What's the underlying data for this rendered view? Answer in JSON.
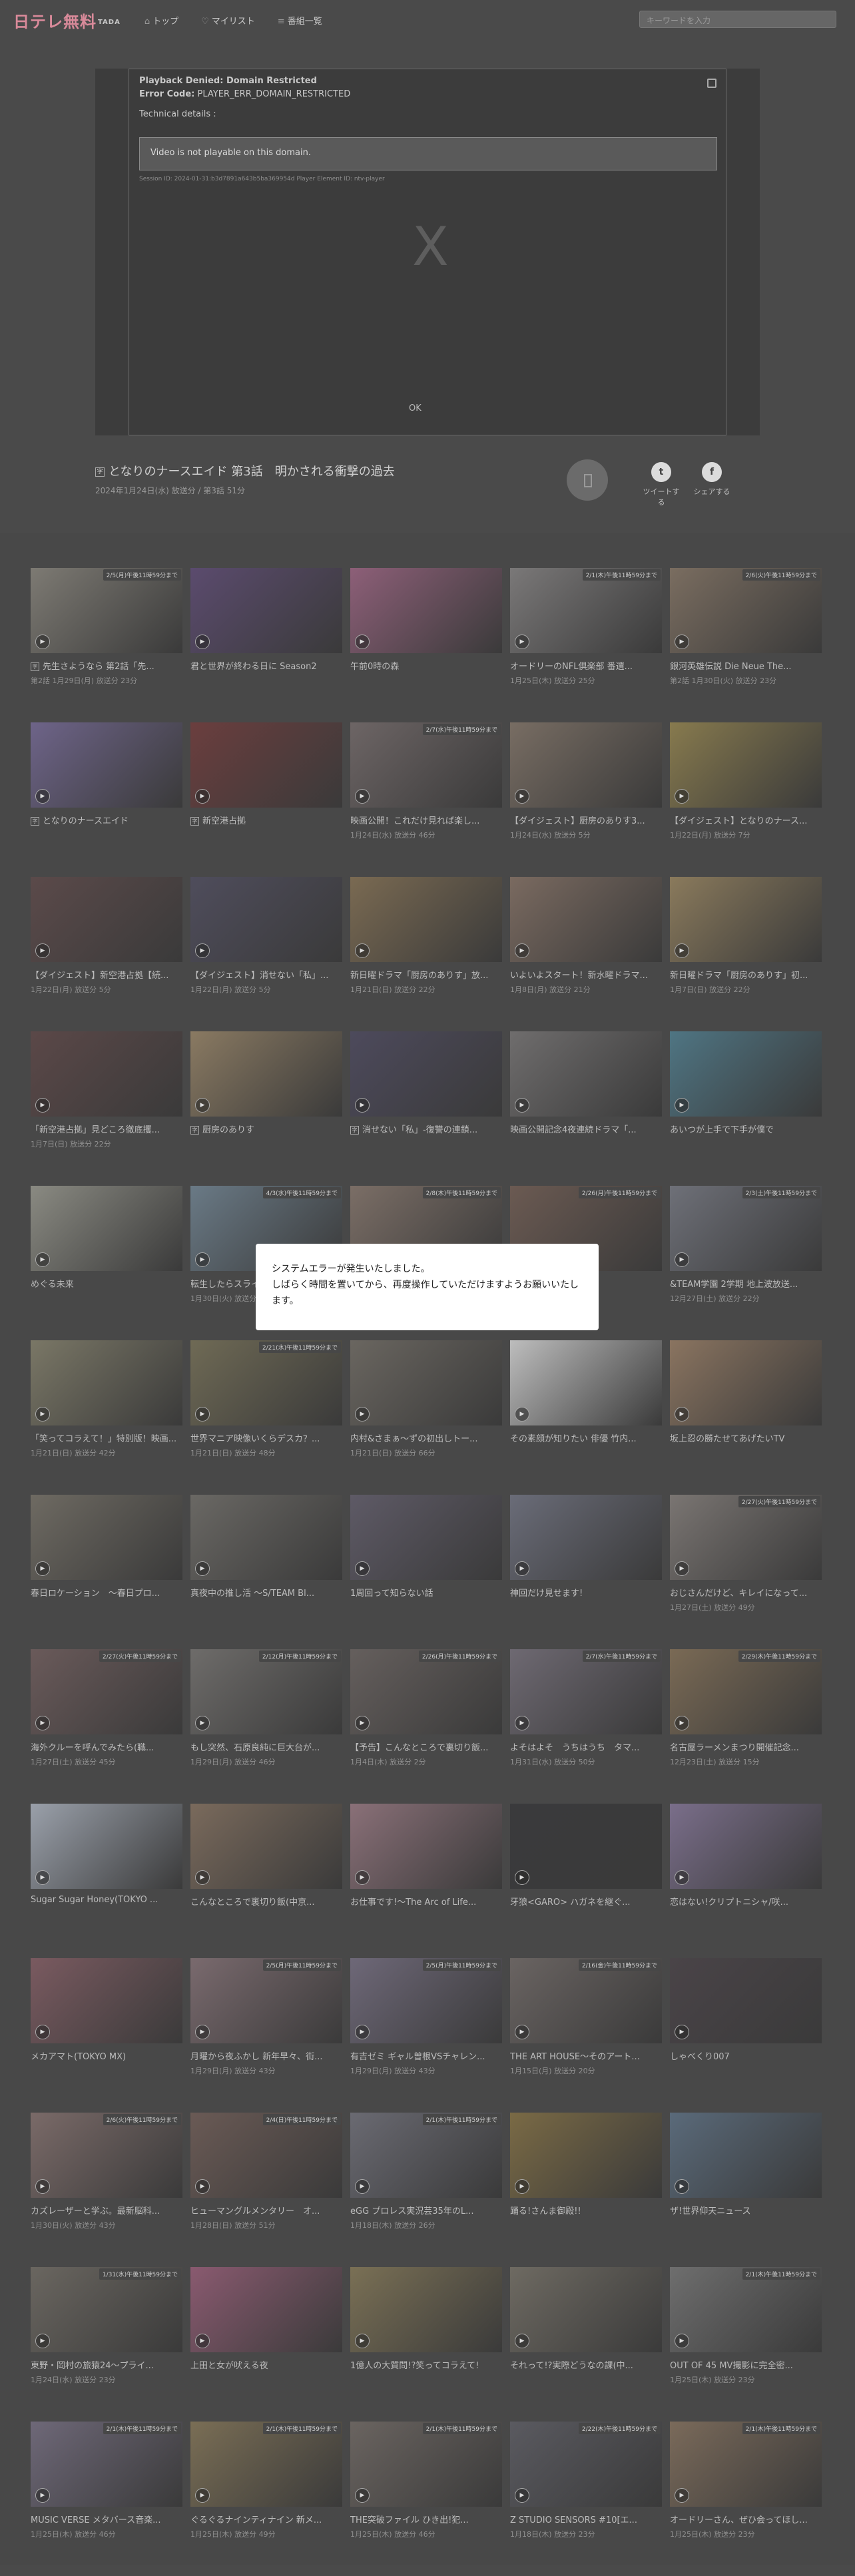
{
  "header": {
    "logo": "日テレ無料",
    "logo_sub": "TADA",
    "nav": [
      {
        "label": "トップ",
        "icon": "home-icon"
      },
      {
        "label": "マイリスト",
        "icon": "list-icon"
      },
      {
        "label": "番組一覧",
        "icon": "menu-icon"
      }
    ],
    "search_placeholder": "キーワードを入力"
  },
  "player": {
    "error_title": "Playback Denied: Domain Restricted",
    "error_code_label": "Error Code:",
    "error_code": "PLAYER_ERR_DOMAIN_RESTRICTED",
    "tech_label": "Technical details :",
    "message": "Video is not playable on this domain.",
    "session": "Session ID: 2024-01-31:b3d7891a643b5ba369954d Player Element ID: ntv-player",
    "ok": "OK",
    "x": "X"
  },
  "info": {
    "title": "となりのナースエイド 第3話　明かされる衝撃の過去",
    "meta": "2024年1月24日(水) 放送分 / 第3話 51分",
    "tweet": "ツイートする",
    "share": "シェアする"
  },
  "dialog": {
    "line1": "システムエラーが発生いたしました。",
    "line2": "しばらく時間を置いてから、再度操作していただけますようお願いいたします。"
  },
  "cards": [
    {
      "title": "先生さようなら 第2話「先...",
      "date": "第2話 1月29日(月) 放送分 23分",
      "badge": "2/5(月)午後11時59分まで",
      "tag": true,
      "color": "#7d7a73"
    },
    {
      "title": "君と世界が終わる日に Season2",
      "date": "",
      "badge": "",
      "tag": false,
      "color": "#5b4b6e"
    },
    {
      "title": "午前0時の森",
      "date": "",
      "badge": "",
      "tag": false,
      "color": "#8d5f78"
    },
    {
      "title": "オードリーのNFL倶楽部 番選...",
      "date": "1月25日(木) 放送分 25分",
      "badge": "2/1(木)午後11時59分まで",
      "tag": false,
      "color": "#7a7878"
    },
    {
      "title": "銀河英雄伝説 Die Neue The...",
      "date": "第2話 1月30日(火) 放送分 23分",
      "badge": "2/6(火)午後11時59分まで",
      "tag": false,
      "color": "#7a6d60"
    },
    {
      "title": "となりのナースエイド",
      "date": "",
      "badge": "",
      "tag": true,
      "color": "#6e6489"
    },
    {
      "title": "新空港占拠",
      "date": "",
      "badge": "",
      "tag": true,
      "color": "#6b3e3e"
    },
    {
      "title": "映画公開！これだけ見れば楽し...",
      "date": "1月24日(水) 放送分 46分",
      "badge": "2/7(水)午後11時59分まで",
      "tag": false,
      "color": "#6d6565"
    },
    {
      "title": "【ダイジェスト】厨房のありす3...",
      "date": "1月24日(水) 放送分 5分",
      "badge": "",
      "tag": false,
      "color": "#786d63"
    },
    {
      "title": "【ダイジェスト】となりのナース...",
      "date": "1月22日(月) 放送分 7分",
      "badge": "",
      "tag": false,
      "color": "#877a4e"
    },
    {
      "title": "【ダイジェスト】新空港占拠【続...",
      "date": "1月22日(月) 放送分 5分",
      "badge": "",
      "tag": false,
      "color": "#5b4a4a"
    },
    {
      "title": "【ダイジェスト】消せない「私」...",
      "date": "1月22日(月) 放送分 5分",
      "badge": "",
      "tag": false,
      "color": "#4f4d5c"
    },
    {
      "title": "新日曜ドラマ「厨房のありす」放...",
      "date": "1月21日(日) 放送分 22分",
      "badge": "",
      "tag": false,
      "color": "#7a6a52"
    },
    {
      "title": "いよいよスタート！新水曜ドラマ...",
      "date": "1月8日(月) 放送分 21分",
      "badge": "",
      "tag": false,
      "color": "#7a6a60"
    },
    {
      "title": "新日曜ドラマ「厨房のありす」初...",
      "date": "1月7日(日) 放送分 22分",
      "badge": "",
      "tag": false,
      "color": "#8a7a5c"
    },
    {
      "title": "「新空港占拠」見どころ徹底攫...",
      "date": "1月7日(日) 放送分 22分",
      "badge": "",
      "tag": false,
      "color": "#5b4848"
    },
    {
      "title": "厨房のありす",
      "date": "",
      "badge": "",
      "tag": true,
      "color": "#8a7a62"
    },
    {
      "title": "消せない「私」-復讐の連鎖...",
      "date": "",
      "badge": "",
      "tag": true,
      "color": "#4d4a5c"
    },
    {
      "title": "映画公開記念4夜連続ドラマ「...",
      "date": "",
      "badge": "",
      "tag": false,
      "color": "#6f6d6d"
    },
    {
      "title": "あいつが上手で下手が僕で",
      "date": "",
      "badge": "",
      "tag": false,
      "color": "#4f7583"
    },
    {
      "title": "めぐる未来",
      "date": "",
      "badge": "",
      "tag": false,
      "color": "#8a8a82"
    },
    {
      "title": "転生したらスライムだった件",
      "date": "1月30日(火) 放送分 23分",
      "badge": "4/3(水)午後11時59分まで",
      "tag": false,
      "color": "#6a7a86"
    },
    {
      "title": "",
      "date": "",
      "badge": "2/8(木)午後11時59分まで",
      "tag": false,
      "color": "#7b6e66"
    },
    {
      "title": "...スペシャル(B...",
      "date": "",
      "badge": "2/26(月)午後11時59分まで",
      "tag": false,
      "color": "#6b5a52"
    },
    {
      "title": "&TEAM学園 2学期 地上波放送...",
      "date": "12月27日(土) 放送分 22分",
      "badge": "2/3(土)午後11時59分まで",
      "tag": false,
      "color": "#6e7078"
    },
    {
      "title": "「笑ってコラえて！」特別版！映画...",
      "date": "1月21日(日) 放送分 42分",
      "badge": "",
      "tag": false,
      "color": "#7a7766"
    },
    {
      "title": "世界マニア映像いくらデスカ？...",
      "date": "1月21日(日) 放送分 48分",
      "badge": "2/21(水)午後11時59分まで",
      "tag": false,
      "color": "#6f6a55"
    },
    {
      "title": "内村&さまぁ～ずの初出しトー...",
      "date": "1月21日(日) 放送分 66分",
      "badge": "",
      "tag": false,
      "color": "#6a6660"
    },
    {
      "title": "その素顔が知りたい 俳優 竹内...",
      "date": "",
      "badge": "",
      "tag": false,
      "color": "#bdbdbd"
    },
    {
      "title": "坂上忍の勝たせてあげたいTV",
      "date": "",
      "badge": "",
      "tag": false,
      "color": "#8a7460"
    },
    {
      "title": "春日ロケーション　～春日プロ...",
      "date": "",
      "badge": "",
      "tag": false,
      "color": "#6e6a62"
    },
    {
      "title": "真夜中の推し活 ～S/TEAM Bl...",
      "date": "",
      "badge": "",
      "tag": false,
      "color": "#6a6864"
    },
    {
      "title": "1周回って知らない話",
      "date": "",
      "badge": "",
      "tag": false,
      "color": "#5e5a66"
    },
    {
      "title": "神回だけ見せます!",
      "date": "",
      "badge": "",
      "tag": false,
      "color": "#6a6c78"
    },
    {
      "title": "おじさんだけど、キレイになって...",
      "date": "1月27日(土) 放送分 49分",
      "badge": "2/27(火)午後11時59分まで",
      "tag": false,
      "color": "#7a7572"
    },
    {
      "title": "海外クルーを呼んでみたら(職...",
      "date": "1月27日(土) 放送分 45分",
      "badge": "2/27(火)午後11時59分まで",
      "tag": false,
      "color": "#6a5a5a"
    },
    {
      "title": "もし突然、石原良純に巨大台が...",
      "date": "1月29日(月) 放送分 46分",
      "badge": "2/12(月)午後11時59分まで",
      "tag": false,
      "color": "#6e6c6a"
    },
    {
      "title": "【予告】こんなところで裏切り飯...",
      "date": "1月4日(木) 放送分 2分",
      "badge": "2/26(月)午後11時59分まで",
      "tag": false,
      "color": "#655f5d"
    },
    {
      "title": "よそはよそ　うちはうち　タマ...",
      "date": "1月31日(水) 放送分 50分",
      "badge": "2/7(水)午後11時59分まで",
      "tag": false,
      "color": "#6e6972"
    },
    {
      "title": "名古屋ラーメンまつり開催記念...",
      "date": "12月23日(土) 放送分 15分",
      "badge": "2/29(木)午後11時59分まで",
      "tag": false,
      "color": "#7a6a55"
    },
    {
      "title": "Sugar Sugar Honey(TOKYO ...",
      "date": "",
      "badge": "",
      "tag": false,
      "color": "#9aa0aa"
    },
    {
      "title": "こんなところで裏切り飯(中京...",
      "date": "",
      "badge": "",
      "tag": false,
      "color": "#7a6a5c"
    },
    {
      "title": "お仕事です!～The Arc of Life...",
      "date": "",
      "badge": "",
      "tag": false,
      "color": "#8a7078"
    },
    {
      "title": "牙狼<GARO> ハガネを継ぐ...",
      "date": "",
      "badge": "",
      "tag": false,
      "color": "#3a3a3c"
    },
    {
      "title": "恋はない!クリプトニシャ/咲...",
      "date": "",
      "badge": "",
      "tag": false,
      "color": "#7a6e8a"
    },
    {
      "title": "メカアマト(TOKYO MX)",
      "date": "",
      "badge": "",
      "tag": false,
      "color": "#7a5a60"
    },
    {
      "title": "月曜から夜ふかし 新年早々、街...",
      "date": "1月29日(月) 放送分 43分",
      "badge": "2/5(月)午後11時59分まで",
      "tag": false,
      "color": "#7a6a6e"
    },
    {
      "title": "有吉ゼミ ギャル曽根VSチャレン...",
      "date": "1月29日(月) 放送分 43分",
      "badge": "2/5(月)午後11時59分まで",
      "tag": false,
      "color": "#6e6878"
    },
    {
      "title": "THE ART HOUSE～そのアート...",
      "date": "1月15日(月) 放送分 20分",
      "badge": "2/16(金)午後11時59分まで",
      "tag": false,
      "color": "#6a6462"
    },
    {
      "title": "しゃべくり007",
      "date": "",
      "badge": "",
      "tag": false,
      "color": "#4a4448"
    },
    {
      "title": "カズレーザーと学ぶ。最新脳科...",
      "date": "1月30日(火) 放送分 43分",
      "badge": "2/6(火)午後11時59分まで",
      "tag": false,
      "color": "#7a6a68"
    },
    {
      "title": "ヒューマングルメンタリー　オ...",
      "date": "1月28日(日) 放送分 51分",
      "badge": "2/4(日)午後11時59分まで",
      "tag": false,
      "color": "#6a5a55"
    },
    {
      "title": "eGG プロレス実況芸35年のL...",
      "date": "1月18日(木) 放送分 26分",
      "badge": "2/1(木)午後11時59分まで",
      "tag": false,
      "color": "#6a6a72"
    },
    {
      "title": "踊る!さんま御殿!!",
      "date": "",
      "badge": "",
      "tag": false,
      "color": "#7a6a45"
    },
    {
      "title": "ザ!世界仰天ニュース",
      "date": "",
      "badge": "",
      "tag": false,
      "color": "#5a6a7a"
    },
    {
      "title": "東野・岡村の旅猿24～プライ...",
      "date": "1月24日(水) 放送分 23分",
      "badge": "1/31(水)午後11時59分まで",
      "tag": false,
      "color": "#6a6660"
    },
    {
      "title": "上田と女が吠える夜",
      "date": "",
      "badge": "",
      "tag": false,
      "color": "#8a5a70"
    },
    {
      "title": "1億人の大質問!?笑ってコラえて!",
      "date": "",
      "badge": "",
      "tag": false,
      "color": "#7a7055"
    },
    {
      "title": "それって!?実際どうなの課(中...",
      "date": "",
      "badge": "",
      "tag": false,
      "color": "#6e6a62"
    },
    {
      "title": "OUT OF 45 MV撮影に完全密...",
      "date": "1月25日(木) 放送分 23分",
      "badge": "2/1(木)午後11時59分まで",
      "tag": false,
      "color": "#6e6e6e"
    },
    {
      "title": "MUSIC VERSE メタバース音楽...",
      "date": "1月25日(木) 放送分 46分",
      "badge": "2/1(木)午後11時59分まで",
      "tag": false,
      "color": "#6e6878"
    },
    {
      "title": "ぐるぐるナインティナイン 新メ...",
      "date": "1月25日(木) 放送分 49分",
      "badge": "2/1(木)午後11時59分まで",
      "tag": false,
      "color": "#7a6e55"
    },
    {
      "title": "THE突破ファイル ひき出!犯...",
      "date": "1月25日(木) 放送分 46分",
      "badge": "2/1(木)午後11時59分まで",
      "tag": false,
      "color": "#6a6460"
    },
    {
      "title": "Z STUDIO SENSORS #10[エ...",
      "date": "1月18日(木) 放送分 23分",
      "badge": "2/22(木)午後11時59分まで",
      "tag": false,
      "color": "#5a5a60"
    },
    {
      "title": "オードリーさん、ぜひ会ってほし...",
      "date": "1月25日(木) 放送分 23分",
      "badge": "2/1(木)午後11時59分まで",
      "tag": false,
      "color": "#7a6a5a"
    }
  ]
}
